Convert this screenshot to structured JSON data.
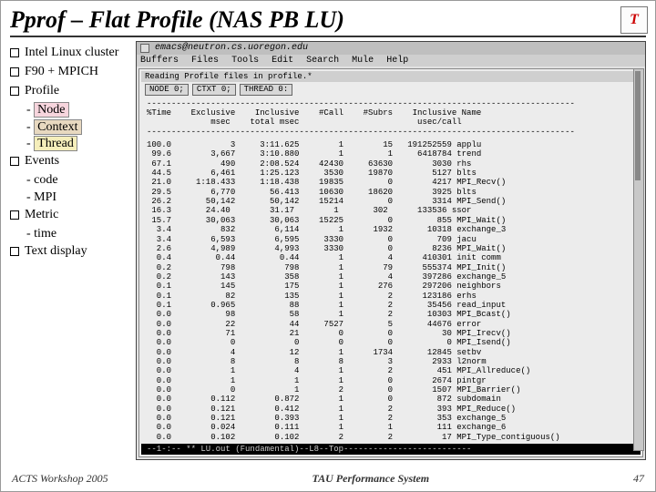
{
  "title": "Pprof – Flat Profile (NAS PB LU)",
  "logo": "T",
  "bul": [
    "Intel Linux cluster",
    "F90 + MPICH",
    "Profile",
    "Events",
    "Metric",
    "Text display"
  ],
  "sub": [
    "Node",
    "Context",
    "Thread",
    "- code",
    "- MPI",
    "- time"
  ],
  "term": {
    "host": "emacs@neutron.cs.uoregon.edu",
    "menu": [
      "Buffers",
      "Files",
      "Tools",
      "Edit",
      "Search",
      "Mule",
      "Help"
    ],
    "reading": "Reading Profile files in profile.*",
    "btn": [
      "NODE 0;",
      "CTXT 0;",
      "THREAD 0:"
    ],
    "header": "---------------------------------------------------------------------------------------\n%Time    Exclusive    Inclusive    #Call    #Subrs    Inclusive Name\n             msec    total msec                        usec/call\n---------------------------------------------------------------------------------------",
    "rows": "100.0            3     3:11.625        1        15   191252559 applu\n 99.6        3,667     3:10.880        1         1     6418784 trend\n 67.1          490     2:08.524    42430     63630        3030 rhs\n 44.5        6,461     1:25.123     3530     19870        5127 blts\n 21.0     1:18.433     1:18.438    19835         0        4217 MPI_Recv()\n 29.5        6,770       56.413    10630     18620        3925 blts\n 26.2       50,142       50,142    15214         0        3314 MPI_Send()\n 16.3       24.40        31.17        1       302      133536 ssor\n 15.7       30,063       30,063    15225         0         855 MPI_Wait()\n  3.4          832        6,114        1      1932       10318 exchange_3\n  3.4        6,593        6,595     3330         0         709 jacu\n  2.6        4,989        4,993     3330         0        8236 MPI_Wait()\n  0.4         0.44         0.44        1         4      410301 init comm\n  0.2          798          798        1        79      555374 MPI_Init()\n  0.2          143          358        1         4      397286 exchange_5\n  0.1          145          175        1       276      297206 neighbors\n  0.1           82          135        1         2      123186 erhs\n  0.1        0.965           88        1         2       35456 read_input\n  0.0           98           58        1         2       10303 MPI_Bcast()\n  0.0           22           44     7527         5       44676 error\n  0.0           71           21        0         0          30 MPI_Irecv()\n  0.0            0            0        0         0           0 MPI_Isend()\n  0.0            4           12        1      1734       12845 setbv\n  0.0            8            8        8         3        2933 l2norm\n  0.0            1            4        1         2         451 MPI_Allreduce()\n  0.0            1            1        1         0        2674 pintgr\n  0.0            0            1        2         0        1507 MPI_Barrier()\n  0.0        0.112        0.872        1         0         872 subdomain\n  0.0        0.121        0.412        1         2         393 MPI_Reduce()\n  0.0        0.121        0.393        1         2         353 exchange_5\n  0.0        0.024        0.111        1         1         111 exchange_6\n  0.0        0.102        0.102        2         2          17 MPI_Type_contiguous()",
    "foot": "--1-:--  **  LU.out          (Fundamental)--L8--Top--------------------------"
  },
  "footer": {
    "left": "ACTS Workshop 2005",
    "center": "TAU Performance System",
    "right": "47"
  }
}
